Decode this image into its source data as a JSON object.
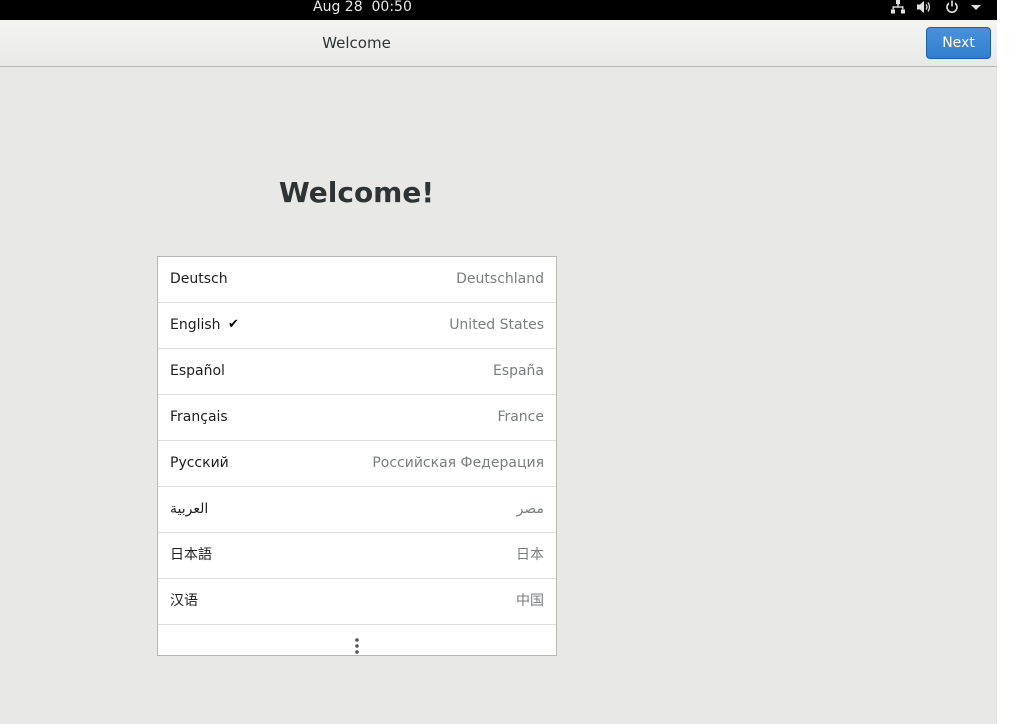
{
  "topbar": {
    "clock": "Aug 28  00:50",
    "icons": [
      "network-icon",
      "volume-icon",
      "power-icon",
      "chevron-down-icon"
    ]
  },
  "header": {
    "title": "Welcome",
    "next_label": "Next"
  },
  "main": {
    "heading": "Welcome!",
    "languages": [
      {
        "name": "Deutsch",
        "region": "Deutschland",
        "selected": false
      },
      {
        "name": "English",
        "region": "United States",
        "selected": true
      },
      {
        "name": "Español",
        "region": "España",
        "selected": false
      },
      {
        "name": "Français",
        "region": "France",
        "selected": false
      },
      {
        "name": "Русский",
        "region": "Российская Федерация",
        "selected": false
      },
      {
        "name": "العربية",
        "region": "مصر",
        "selected": false
      },
      {
        "name": "日本語",
        "region": "日本",
        "selected": false
      },
      {
        "name": "汉语",
        "region": "中国",
        "selected": false
      }
    ],
    "check_glyph": "✔",
    "more_icon": "more-vertical-icon"
  },
  "colors": {
    "accent": "#3584e4",
    "background": "#e8e8e7",
    "header": "#efefee"
  }
}
